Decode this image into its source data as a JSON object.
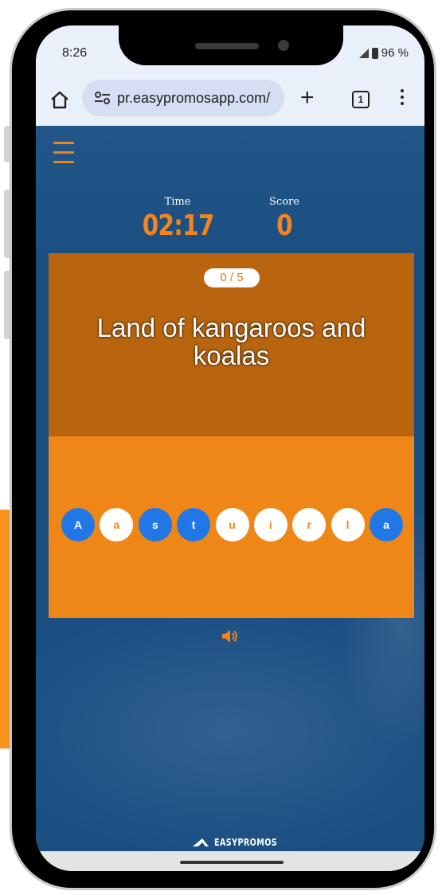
{
  "status_bar": {
    "time": "8:26",
    "battery": "96 %"
  },
  "browser": {
    "url": "pr.easypromosapp.com/",
    "tab_count": "1"
  },
  "game": {
    "time_label": "Time",
    "time_value": "02:17",
    "score_label": "Score",
    "score_value": "0",
    "progress": "0 / 5",
    "question": "Land of kangaroos and koalas",
    "letters": [
      {
        "char": "A",
        "selected": true
      },
      {
        "char": "a",
        "selected": false
      },
      {
        "char": "s",
        "selected": true
      },
      {
        "char": "t",
        "selected": true
      },
      {
        "char": "u",
        "selected": false
      },
      {
        "char": "i",
        "selected": false
      },
      {
        "char": "r",
        "selected": false
      },
      {
        "char": "l",
        "selected": false
      },
      {
        "char": "a",
        "selected": true
      }
    ]
  },
  "footer": {
    "brand": "EASYPROMOS"
  },
  "colors": {
    "background_blue": "#1b4f82",
    "accent_orange": "#ef8718",
    "card_dark_orange": "#b9650f",
    "selected_blue": "#2277e6"
  },
  "icons": [
    "home-icon",
    "site-settings-icon",
    "plus-icon",
    "tabs-icon",
    "more-menu-icon",
    "hamburger-menu-icon",
    "sound-icon",
    "easypromos-logo-icon"
  ]
}
